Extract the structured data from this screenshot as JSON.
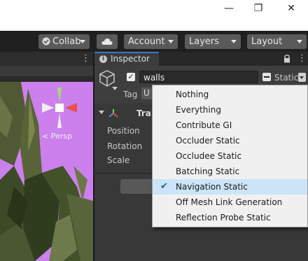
{
  "window": {
    "minimize_glyph": "—",
    "restore_glyph": "❐",
    "close_glyph": "✕"
  },
  "toolbar": {
    "collab": "Collab",
    "account": "Account",
    "layers": "Layers",
    "layout": "Layout"
  },
  "scene": {
    "more_glyph": "⋮",
    "gizmo_label": "< Persp"
  },
  "inspector": {
    "tab_label": "Inspector",
    "object_name": "walls",
    "static_label": "Static",
    "tag_label": "Tag",
    "tag_value": "U",
    "transform_label": "Tra",
    "fields": [
      "Position",
      "Rotation",
      "Scale"
    ]
  },
  "static_menu": {
    "items": [
      {
        "label": "Nothing",
        "checked": false
      },
      {
        "label": "Everything",
        "checked": false
      },
      {
        "label": "Contribute GI",
        "checked": false
      },
      {
        "label": "Occluder Static",
        "checked": false
      },
      {
        "label": "Occludee Static",
        "checked": false
      },
      {
        "label": "Batching Static",
        "checked": false
      },
      {
        "label": "Navigation Static",
        "checked": true
      },
      {
        "label": "Off Mesh Link Generation",
        "checked": false
      },
      {
        "label": "Reflection Probe Static",
        "checked": false
      }
    ]
  },
  "colors": {
    "accent": "#3a79bb",
    "scene_sky": "#cc80ee",
    "menu_bg": "#f0f0f0",
    "selection": "#cce4f7"
  }
}
